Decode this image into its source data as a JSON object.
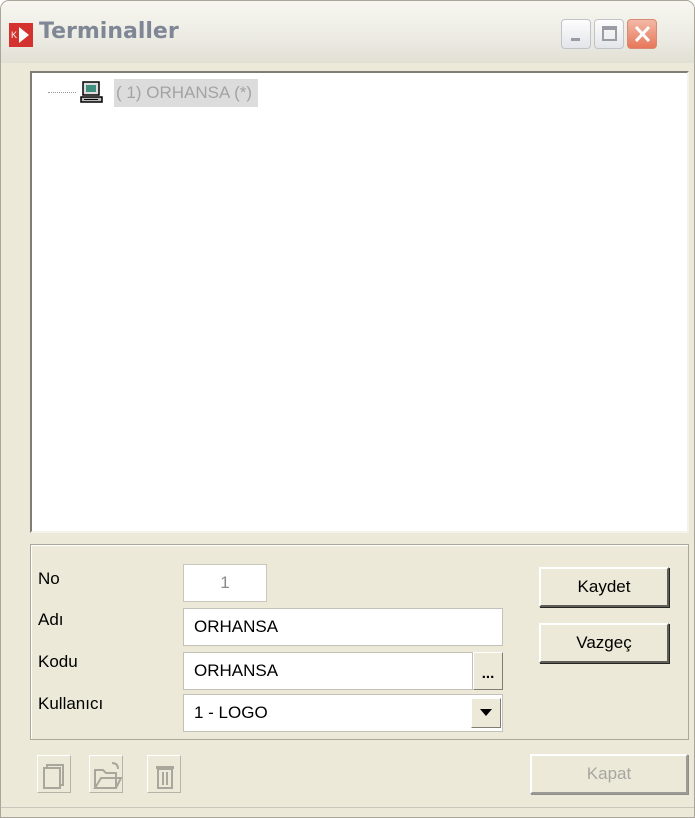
{
  "window": {
    "title": "Terminaller",
    "controls": [
      "minimize",
      "maximize",
      "close"
    ]
  },
  "tree": {
    "items": [
      {
        "label": "( 1) ORHANSA (*)",
        "icon": "computer-icon"
      }
    ]
  },
  "form": {
    "no_label": "No",
    "no_value": "1",
    "adi_label": "Adı",
    "adi_value": "ORHANSA",
    "kodu_label": "Kodu",
    "kodu_value": "ORHANSA",
    "kodu_lookup": "...",
    "kullanici_label": "Kullanıcı",
    "kullanici_value": "1 - LOGO"
  },
  "buttons": {
    "save": "Kaydet",
    "cancel": "Vazgeç",
    "close": "Kapat"
  },
  "toolbar": {
    "icons": [
      "new-document-icon",
      "open-folder-icon",
      "delete-trash-icon"
    ]
  },
  "colors": {
    "face": "#ece9d8",
    "title_text": "#7f8796",
    "close_button": "#e7775a",
    "selection": "#dcdcdc"
  }
}
